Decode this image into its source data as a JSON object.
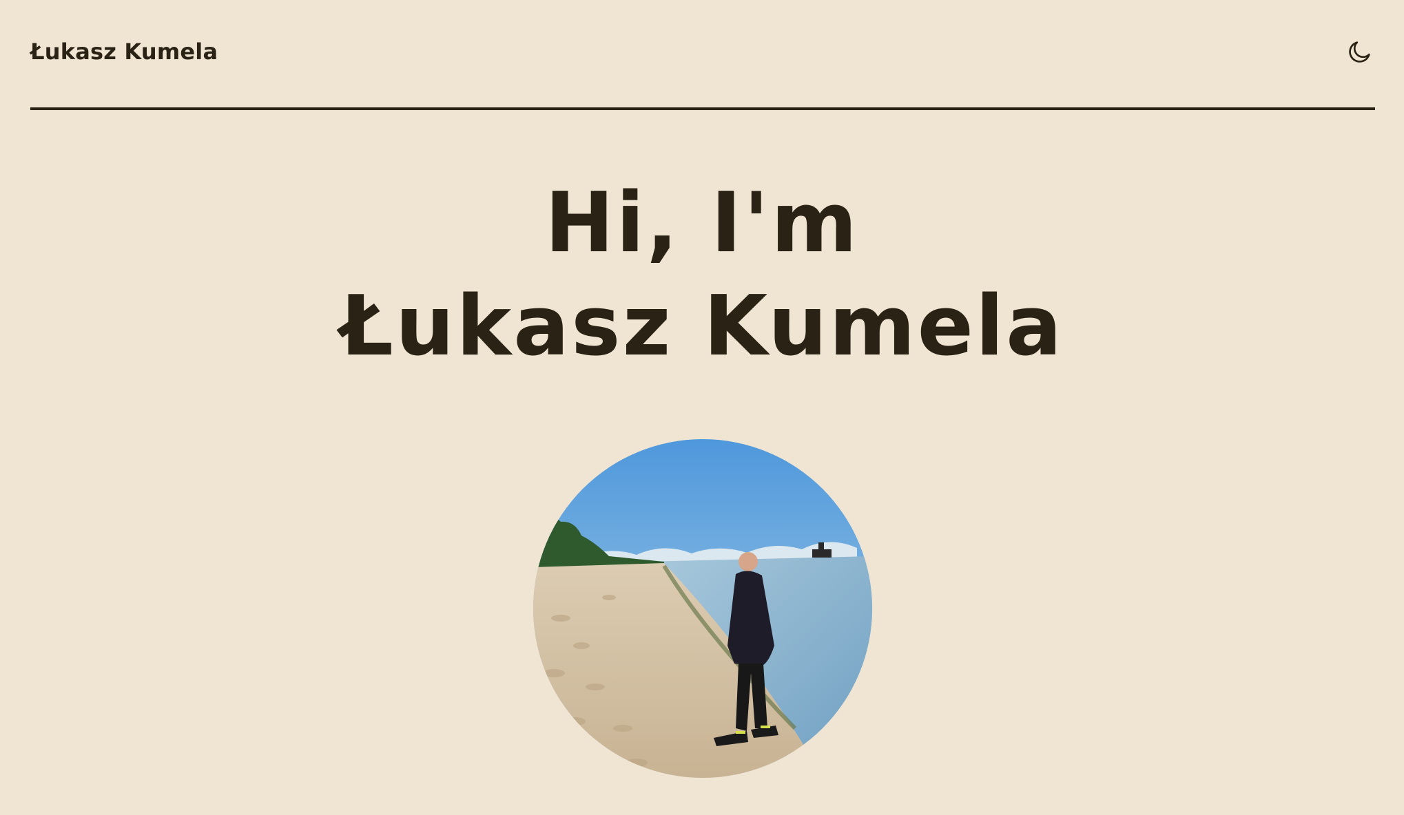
{
  "header": {
    "brand": "Łukasz Kumela",
    "theme_toggle_icon": "moon-icon"
  },
  "hero": {
    "greeting": "Hi, I'm",
    "name": "Łukasz Kumela"
  },
  "avatar": {
    "icon": "profile-photo-beach"
  },
  "colors": {
    "background": "#f0e4d3",
    "text": "#2a2214"
  }
}
